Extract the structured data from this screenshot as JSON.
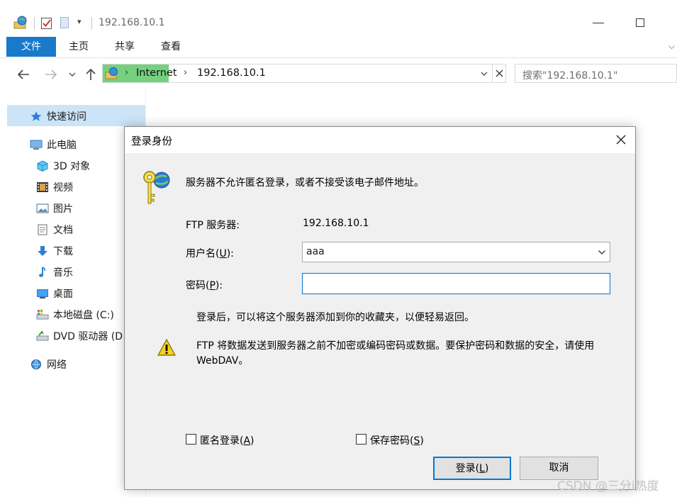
{
  "window": {
    "title": "192.168.10.1"
  },
  "ribbon": {
    "tabs": [
      "文件",
      "主页",
      "共享",
      "查看"
    ]
  },
  "address": {
    "segments": [
      "Internet",
      "192.168.10.1"
    ]
  },
  "search": {
    "placeholder": "搜索\"192.168.10.1\""
  },
  "nav_pane": {
    "quick_access": "快速访问",
    "this_pc": "此电脑",
    "items": [
      {
        "label": "3D 对象",
        "icon": "cube-icon"
      },
      {
        "label": "视频",
        "icon": "film-icon"
      },
      {
        "label": "图片",
        "icon": "picture-icon"
      },
      {
        "label": "文档",
        "icon": "document-icon"
      },
      {
        "label": "下载",
        "icon": "download-icon"
      },
      {
        "label": "音乐",
        "icon": "music-note-icon"
      },
      {
        "label": "桌面",
        "icon": "desktop-icon"
      },
      {
        "label": "本地磁盘 (C:)",
        "icon": "drive-icon"
      },
      {
        "label": "DVD 驱动器 (D",
        "icon": "dvd-drive-icon"
      }
    ],
    "network": "网络"
  },
  "dialog": {
    "title": "登录身份",
    "message": "服务器不允许匿名登录，或者不接受该电子邮件地址。",
    "server_label": "FTP 服务器:",
    "server_value": "192.168.10.1",
    "username_label_pre": "用户名(",
    "username_label_key": "U",
    "username_label_post": "):",
    "username_value": "aaa",
    "password_label_pre": "密码(",
    "password_label_key": "P",
    "password_label_post": "):",
    "password_value": "",
    "info": "登录后，可以将这个服务器添加到你的收藏夹，以便轻易返回。",
    "warning_line1": "FTP 将数据发送到服务器之前不加密或编码密码或数据。要保护密码和数据的安全，请使用",
    "warning_line2": "WebDAV。",
    "anon_pre": "匿名登录(",
    "anon_key": "A",
    "anon_post": ")",
    "anon_checked": false,
    "save_pre": "保存密码(",
    "save_key": "S",
    "save_post": ")",
    "save_checked": false,
    "login_pre": "登录(",
    "login_key": "L",
    "login_post": ")",
    "cancel": "取消"
  },
  "watermark": "CSDN @三分i热度",
  "colors": {
    "accent": "#0078d7",
    "ribbon_file_tab": "#1979ca",
    "address_highlight": "#76d07f",
    "selection": "#cce4f7"
  }
}
